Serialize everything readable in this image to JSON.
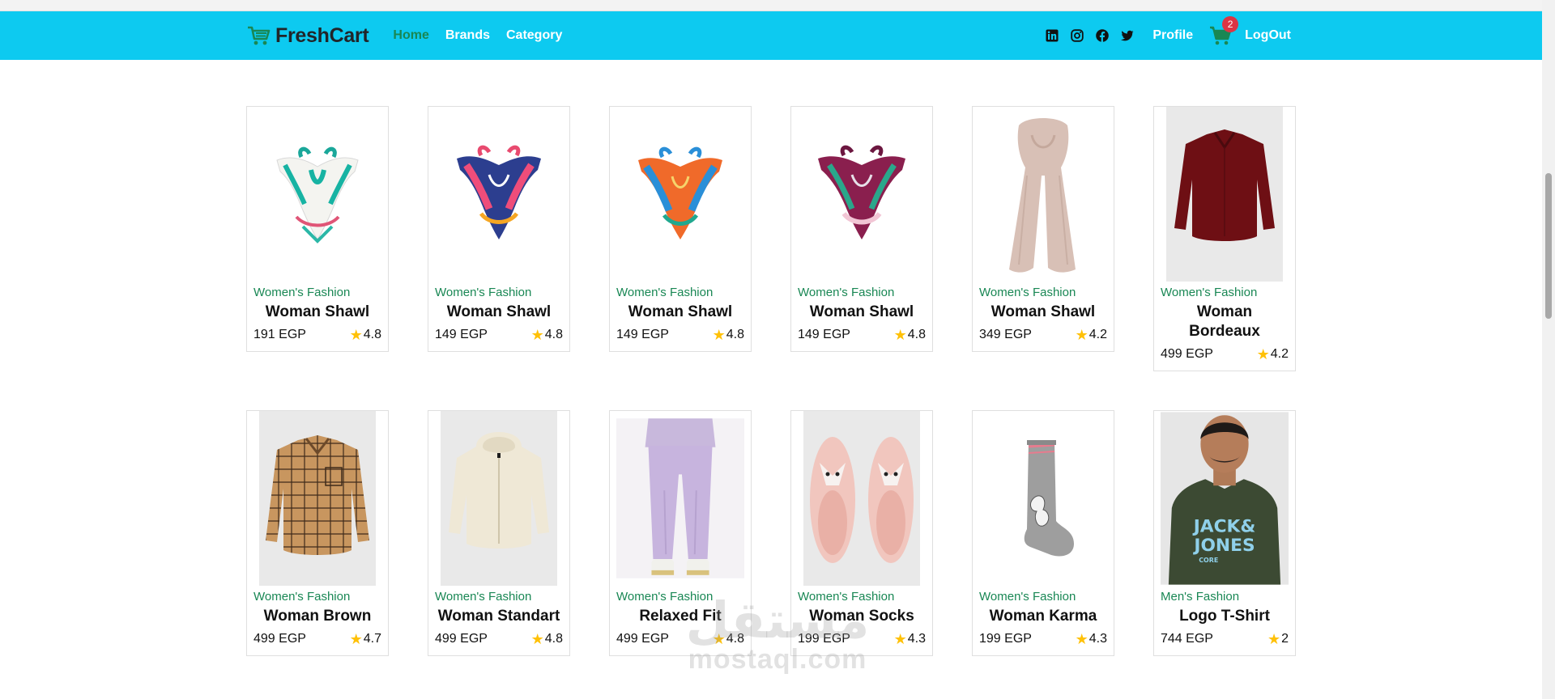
{
  "brand": {
    "name": "FreshCart"
  },
  "nav": {
    "links": [
      "Home",
      "Brands",
      "Category"
    ],
    "profile": "Profile",
    "cart_count": "2",
    "logout": "LogOut"
  },
  "colors": {
    "navbar": "#0dcaf0",
    "accent_green": "#198754",
    "star": "#ffc107",
    "badge": "#dc3545"
  },
  "products": [
    {
      "category": "Women's Fashion",
      "title": "Woman Shawl",
      "price": "191 EGP",
      "rating": "4.8",
      "image": "scarf-white-teal"
    },
    {
      "category": "Women's Fashion",
      "title": "Woman Shawl",
      "price": "149 EGP",
      "rating": "4.8",
      "image": "scarf-navy-pink"
    },
    {
      "category": "Women's Fashion",
      "title": "Woman Shawl",
      "price": "149 EGP",
      "rating": "4.8",
      "image": "scarf-orange-blue"
    },
    {
      "category": "Women's Fashion",
      "title": "Woman Shawl",
      "price": "149 EGP",
      "rating": "4.8",
      "image": "scarf-burgundy"
    },
    {
      "category": "Women's Fashion",
      "title": "Woman Shawl",
      "price": "349 EGP",
      "rating": "4.2",
      "image": "scarf-beige-long"
    },
    {
      "category": "Women's Fashion",
      "title": "Woman Bordeaux",
      "price": "499 EGP",
      "rating": "4.2",
      "image": "blouse-bordeaux"
    },
    {
      "category": "Women's Fashion",
      "title": "Woman Brown",
      "price": "499 EGP",
      "rating": "4.7",
      "image": "shirt-brown-plaid"
    },
    {
      "category": "Women's Fashion",
      "title": "Woman Standart",
      "price": "499 EGP",
      "rating": "4.8",
      "image": "hoodie-cream"
    },
    {
      "category": "Women's Fashion",
      "title": "Relaxed Fit",
      "price": "499 EGP",
      "rating": "4.8",
      "image": "sweatpants-lilac"
    },
    {
      "category": "Women's Fashion",
      "title": "Woman Socks",
      "price": "199 EGP",
      "rating": "4.3",
      "image": "slippers-pink"
    },
    {
      "category": "Women's Fashion",
      "title": "Woman Karma",
      "price": "199 EGP",
      "rating": "4.3",
      "image": "sock-grey"
    },
    {
      "category": "Men's Fashion",
      "title": "Logo T-Shirt",
      "price": "744 EGP",
      "rating": "2",
      "image": "tshirt-jack-jones"
    }
  ],
  "tshirt_print": {
    "line1": "JACK&",
    "line2": "JONES",
    "line3": "CORE"
  },
  "watermark": {
    "arabic": "مستقل",
    "latin": "mostaql.com"
  }
}
